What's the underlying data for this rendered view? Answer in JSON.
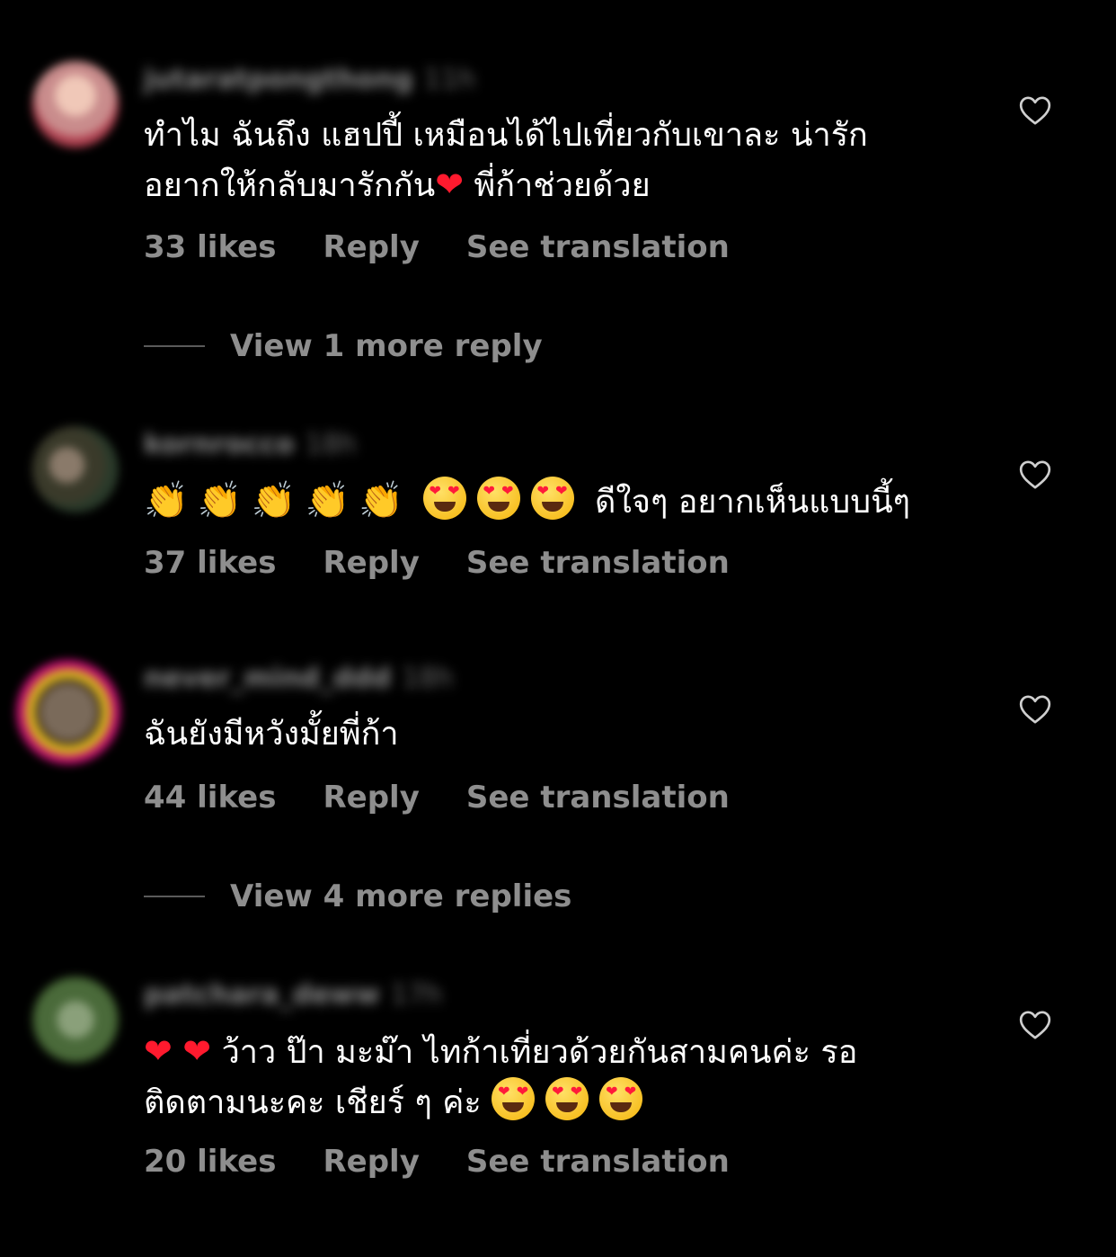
{
  "comments": [
    {
      "username": "jutaratpongthong",
      "time": "11h",
      "text_line1": "ทำไม ฉันถึง แฮปปี้ เหมือนได้ไปเที่ยวกับเขาละ น่ารัก",
      "text_line2_a": "อยากให้กลับมารักกัน",
      "text_line2_b": " พี่ก้าช่วยด้วย",
      "likes": "33 likes",
      "reply": "Reply",
      "translate": "See translation",
      "view_replies": "View 1 more reply",
      "avatar_color": "#c98c8c"
    },
    {
      "username": "kornrocco",
      "time": "18h",
      "text": "ดีใจๆ อยากเห็นแบบนี้ๆ",
      "likes": "37 likes",
      "reply": "Reply",
      "translate": "See translation",
      "avatar_color": "#4a4a3a"
    },
    {
      "username": "never_mind_ddd",
      "time": "18h",
      "text": "ฉันยังมีหวังมั้ยพี่ก้า",
      "likes": "44 likes",
      "reply": "Reply",
      "translate": "See translation",
      "view_replies": "View 4 more replies",
      "avatar_color": "#6a5a4a",
      "ring_color": "#c01070"
    },
    {
      "username": "patchara_deww",
      "time": "17h",
      "text_line1": " ว้าว ป๊า มะม๊า ไทก้าเที่ยวด้วยกันสามคนค่ะ รอ",
      "text_line2": "ติดตามนะคะ เชียร์ ๆ ค่ะ ",
      "likes": "20 likes",
      "reply": "Reply",
      "translate": "See translation",
      "avatar_color": "#5a7a4a"
    }
  ],
  "icons": {
    "like": "heart-outline-icon",
    "red_heart": "red-heart-emoji",
    "heart_eyes": "heart-eyes-emoji",
    "clap": "clapping-hands-emoji"
  },
  "colors": {
    "background": "#000000",
    "text": "#ffffff",
    "secondary": "#8e8e8e"
  }
}
